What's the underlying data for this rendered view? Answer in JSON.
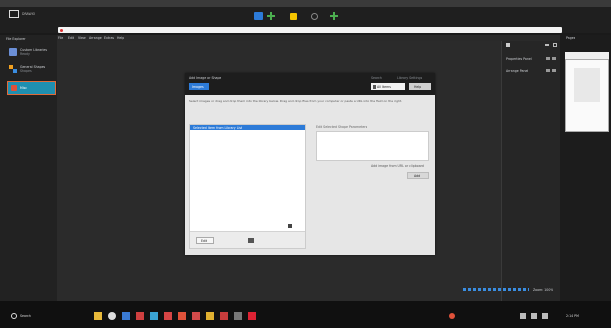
{
  "os_titlebar": {
    "title": ""
  },
  "app": {
    "logo_caption": "DRAWIO",
    "sidebar_header": "File Explorer",
    "sidebar_items": [
      {
        "label": "Custom Libraries",
        "sub": "Ready"
      },
      {
        "label": "General Shapes",
        "sub": "Shapes"
      },
      {
        "label": "Misc",
        "sub": ""
      }
    ],
    "menu_items": [
      "File",
      "Edit",
      "View",
      "Arrange",
      "Extras",
      "Help"
    ],
    "toolbar_icons": [
      "page-icon",
      "add-icon",
      "lock-icon",
      "settings-icon",
      "add-icon"
    ]
  },
  "dialog": {
    "title": "Add Image or Shape",
    "tab_label": "Images",
    "top_right_label_1": "Search",
    "top_right_label_2": "Library Settings",
    "top_right_field": "All Items",
    "top_right_button": "Help",
    "description": "Select images or drag and drop them into the library below. Drag and drop files from your computer or paste a URL into the field on the right.",
    "list_selected": "Selected Item from Library List",
    "right_field_label": "Edit Selected Shape Parameters",
    "right_link": "Add image from URL or clipboard",
    "right_button": "Add",
    "footer_left_label": "Edit",
    "footer_icon": "image-icon"
  },
  "right_panel": {
    "header_icon": "pin-icon",
    "rows": [
      {
        "label": "Properties Panel"
      },
      {
        "label": "Arrange Panel"
      }
    ],
    "footer_status": "Zoom: 100%"
  },
  "thumb_panel": {
    "label": "Pages"
  },
  "taskbar": {
    "search_label": "Search",
    "clock": "2:14 PM",
    "apps": [
      "file-explorer-icon",
      "browser-icon",
      "mail-icon",
      "store-icon",
      "terminal-icon",
      "chat-icon",
      "photo-icon",
      "settings-icon",
      "calendar-icon",
      "music-icon",
      "video-icon",
      "notes-icon"
    ]
  },
  "colors": {
    "accent": "#2d7bd8",
    "workspace_bg": "#2b2b2b",
    "dialog_bg": "#e6e6e6",
    "taskbar_bg": "#101010"
  }
}
